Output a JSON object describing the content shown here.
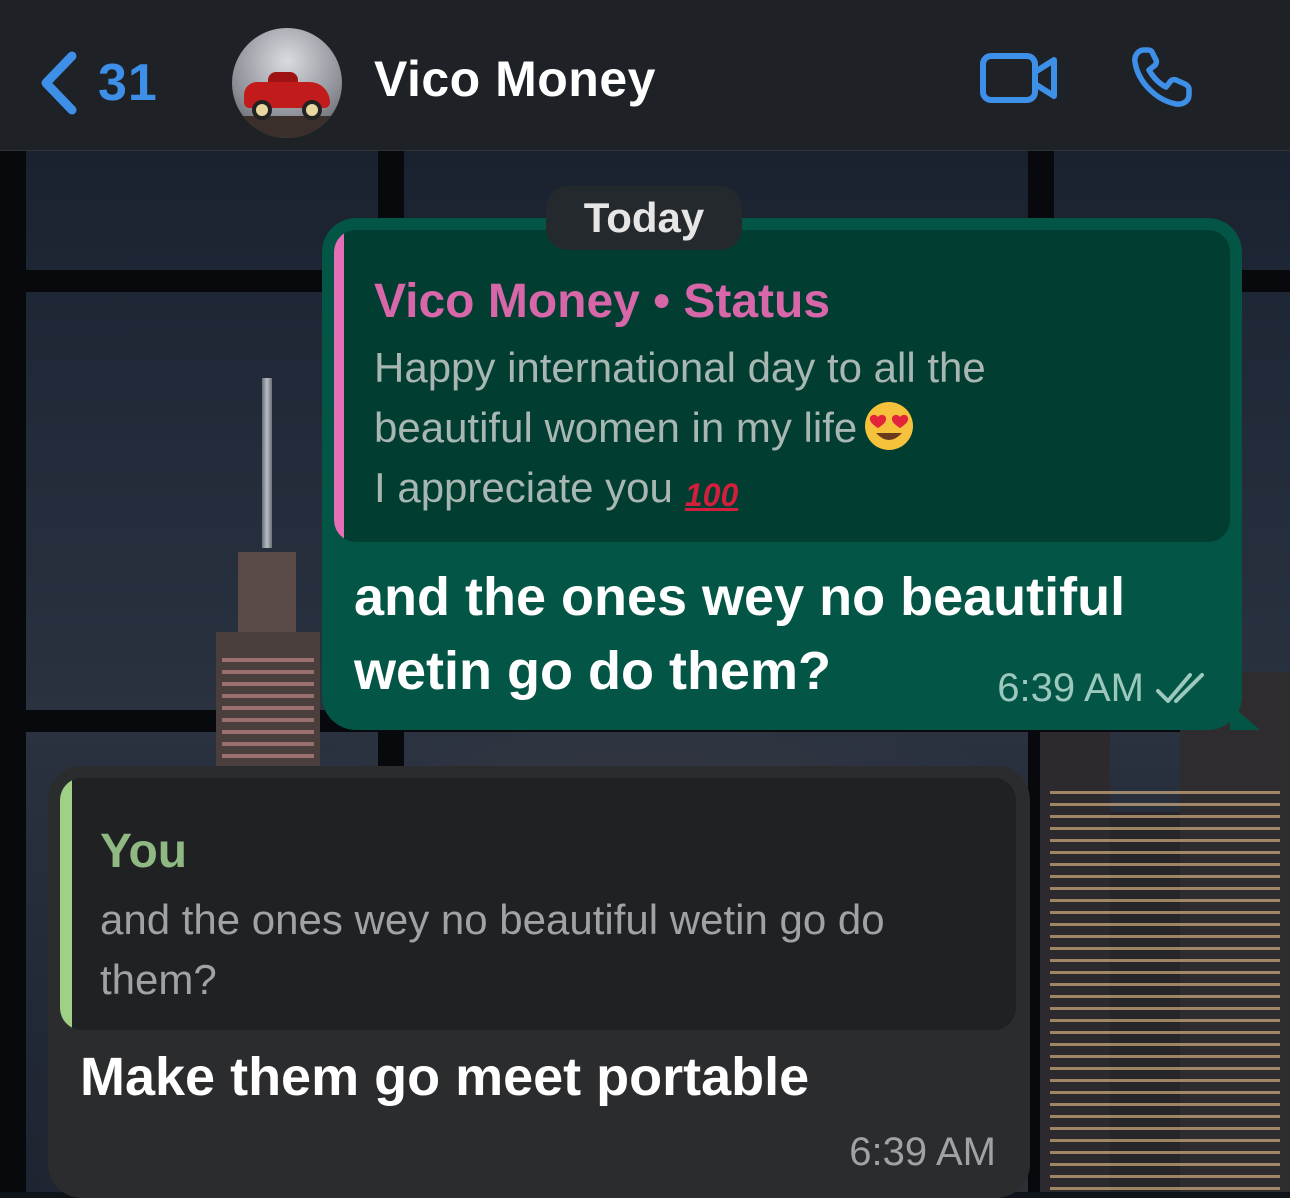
{
  "header": {
    "back_count": "31",
    "contact_name": "Vico Money",
    "avatar_icon": "car-photo-icon",
    "video_icon": "video-call-icon",
    "phone_icon": "voice-call-icon",
    "accent_color": "#3e8fe8"
  },
  "chat": {
    "date_separator": "Today",
    "messages": [
      {
        "direction": "outgoing",
        "quote": {
          "title": "Vico Money • Status",
          "lines": [
            "Happy international day to all the",
            "beautiful women in my life",
            "I appreciate you"
          ],
          "emojis": [
            "heart-eyes-emoji",
            "hundred-points-emoji"
          ],
          "hundred_text": "100"
        },
        "text_lines": [
          "and the ones wey no beautiful",
          "wetin go do them?"
        ],
        "time": "6:39 AM",
        "status_icon": "double-check-icon"
      },
      {
        "direction": "incoming",
        "quote": {
          "title": "You",
          "lines": [
            "and the ones wey no beautiful wetin go do",
            "them?"
          ]
        },
        "text": "Make them go meet portable",
        "time": "6:39 AM"
      }
    ]
  },
  "colors": {
    "outgoing_bubble": "#035545",
    "incoming_bubble": "#2a2c2e",
    "status_quote_bar": "#e46fb6",
    "you_quote_bar": "#9fd085"
  }
}
